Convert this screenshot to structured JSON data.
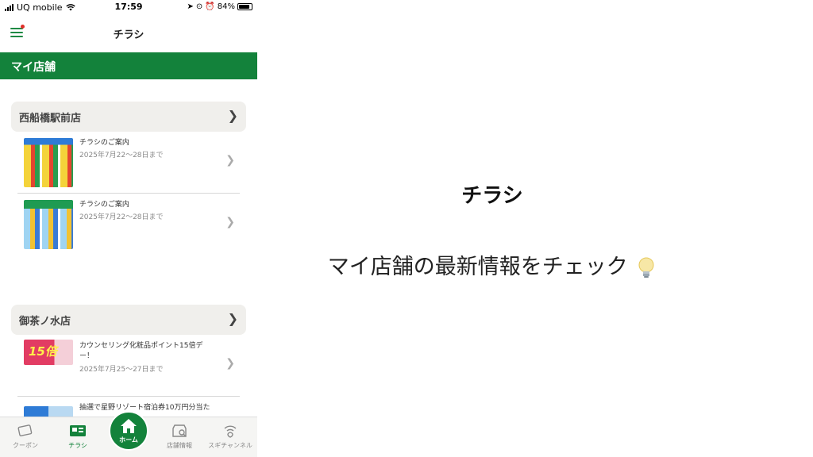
{
  "status_bar": {
    "carrier": "UQ mobile",
    "time": "17:59",
    "battery": "84%"
  },
  "nav": {
    "title": "チラシ"
  },
  "section": {
    "title": "マイ店舗"
  },
  "stores": [
    {
      "name": "西船橋駅前店",
      "flyers": [
        {
          "title": "チラシのご案内",
          "date": "2025年7月22～28日まで"
        },
        {
          "title": "チラシのご案内",
          "date": "2025年7月22～28日まで"
        }
      ]
    },
    {
      "name": "御茶ノ水店",
      "flyers": [
        {
          "title": "カウンセリング化粧品ポイント15倍デー！",
          "date": "2025年7月25～27日まで",
          "promo": "15倍"
        },
        {
          "title": "抽選で星野リゾート宿泊券10万円分当た"
        }
      ]
    }
  ],
  "tabs": {
    "coupon": "クーポン",
    "flyer": "チラシ",
    "home": "ホーム",
    "store_info": "店舗情報",
    "channel": "スギチャンネル"
  },
  "caption": {
    "title": "チラシ",
    "subtitle": "マイ店舗の最新情報をチェック"
  },
  "icons": {
    "menu": "hamburger-icon",
    "chevron": "chevron-right-icon",
    "bulb": "light-bulb-icon"
  },
  "colors": {
    "brand_green": "#13823b",
    "notification_red": "#e0302a"
  }
}
